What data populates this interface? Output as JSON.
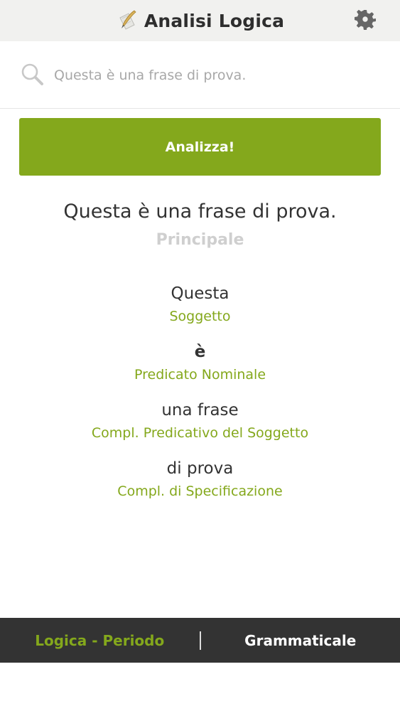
{
  "header": {
    "title": "Analisi Logica",
    "logo_icon": "quill-paper-icon",
    "settings_icon": "gear-icon"
  },
  "search": {
    "placeholder": "Questa è una frase di prova.",
    "value": ""
  },
  "analyze_button": {
    "label": "Analizza!"
  },
  "result": {
    "sentence": "Questa è una frase di prova.",
    "clause_type": "Principale",
    "parts": [
      {
        "word": "Questa",
        "role": "Soggetto"
      },
      {
        "word": "è",
        "role": "Predicato Nominale"
      },
      {
        "word": "una frase",
        "role": "Compl. Predicativo del Soggetto"
      },
      {
        "word": "di prova",
        "role": "Compl. di Specificazione"
      }
    ]
  },
  "bottom_tabs": [
    {
      "label": "Logica - Periodo",
      "active": true
    },
    {
      "label": "Grammaticale",
      "active": false
    }
  ],
  "colors": {
    "accent": "#84a81c",
    "header_bg": "#f1f1ef",
    "bottom_bar_bg": "#333333"
  }
}
